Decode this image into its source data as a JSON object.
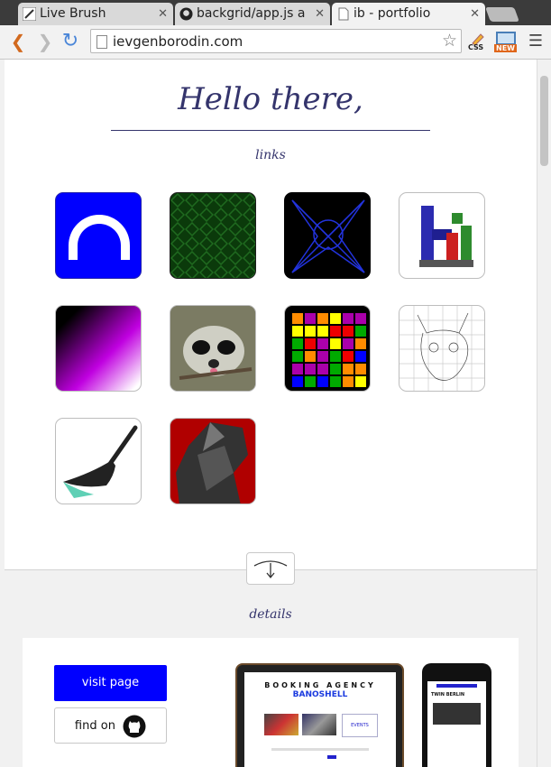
{
  "browser": {
    "tabs": [
      {
        "title": "Live Brush"
      },
      {
        "title": "backgrid/app.js a"
      },
      {
        "title": "ib - portfolio"
      }
    ],
    "url": "ievgenborodin.com",
    "extensions": {
      "css_label": "CSS",
      "new_label": "NEW"
    }
  },
  "page": {
    "title": "Hello there,",
    "links_heading": "links",
    "details_heading": "details",
    "tiles": [
      {
        "name": "half-circle-app"
      },
      {
        "name": "green-pattern-app"
      },
      {
        "name": "star-lines-app"
      },
      {
        "name": "hi-3d-app"
      },
      {
        "name": "gradient-app"
      },
      {
        "name": "raccoon-app"
      },
      {
        "name": "color-grid-game"
      },
      {
        "name": "sketch-cat-app"
      },
      {
        "name": "live-brush-app"
      },
      {
        "name": "poly-art-app"
      }
    ],
    "details": {
      "visit_label": "visit page",
      "github_label": "find on",
      "mock_heading": "BOOKING AGENCY",
      "mock_brand": "BANOSHELL",
      "mock_events": "EVENTS",
      "mock_phone_text": "TWIN BERLIN"
    }
  }
}
